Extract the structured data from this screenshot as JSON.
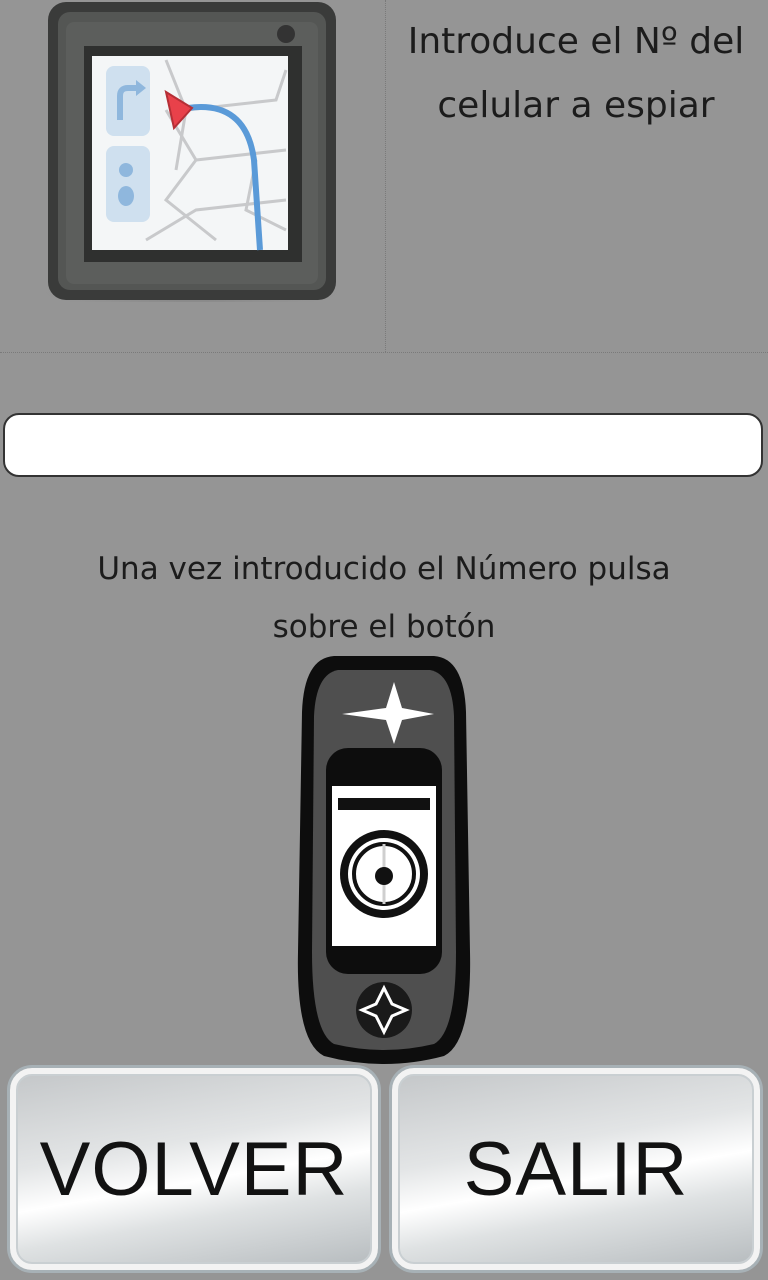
{
  "header": {
    "instruction": "Introduce el Nº del celular a espiar"
  },
  "phone_input": {
    "value": "",
    "placeholder": ""
  },
  "hint": {
    "text": "Una vez introducido el Número pulsa sobre el botón"
  },
  "icons": {
    "navigation_image": "gps-navigation-device-icon",
    "search_button": "handheld-gps-icon"
  },
  "buttons": {
    "back_label": "VOLVER",
    "exit_label": "SALIR"
  },
  "colors": {
    "background": "#959595",
    "input_background": "#ffffff",
    "route_line": "#5a9ad8",
    "marker": "#e8414a"
  }
}
